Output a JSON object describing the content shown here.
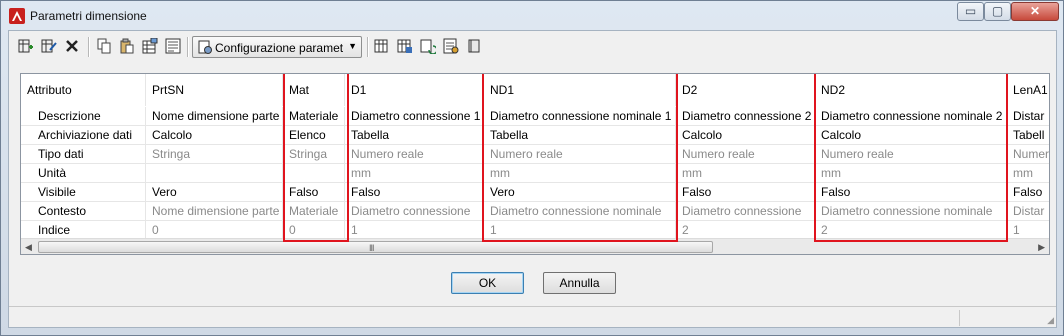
{
  "window": {
    "title": "Parametri dimensione",
    "min_glyph": "▭",
    "max_glyph": "▢",
    "close_glyph": "✕"
  },
  "toolbar": {
    "config_label": "Configurazione paramet",
    "config_arrow": "▼"
  },
  "grid": {
    "columns": [
      {
        "header": "Attributo"
      },
      {
        "header": "PrtSN"
      },
      {
        "header": "Mat"
      },
      {
        "header": "D1"
      },
      {
        "header": "ND1"
      },
      {
        "header": "D2"
      },
      {
        "header": "ND2"
      },
      {
        "header": "LenA1"
      }
    ],
    "rows": [
      {
        "attribute": "Descrizione",
        "gray": false,
        "cells": [
          "Nome dimensione parte",
          "Materiale",
          "Diametro connessione 1",
          "Diametro connessione nominale 1",
          "Diametro connessione 2",
          "Diametro connessione nominale 2",
          "Distar"
        ]
      },
      {
        "attribute": "Archiviazione dati",
        "gray": false,
        "cells": [
          "Calcolo",
          "Elenco",
          "Tabella",
          "Tabella",
          "Calcolo",
          "Calcolo",
          "Tabell"
        ]
      },
      {
        "attribute": "Tipo dati",
        "gray": true,
        "cells": [
          "Stringa",
          "Stringa",
          "Numero reale",
          "Numero reale",
          "Numero reale",
          "Numero reale",
          "Numer"
        ]
      },
      {
        "attribute": "Unità",
        "gray": true,
        "cells": [
          "",
          "",
          "mm",
          "mm",
          "mm",
          "mm",
          "mm"
        ]
      },
      {
        "attribute": "Visibile",
        "gray": false,
        "cells": [
          "Vero",
          "Falso",
          "Falso",
          "Vero",
          "Falso",
          "Falso",
          "Falso"
        ]
      },
      {
        "attribute": "Contesto",
        "gray": true,
        "cells": [
          "Nome dimensione parte",
          "Materiale",
          "Diametro connessione",
          "Diametro connessione nominale",
          "Diametro connessione",
          "Diametro connessione nominale",
          "Distar"
        ]
      },
      {
        "attribute": "Indice",
        "gray": true,
        "cells": [
          "0",
          "0",
          "1",
          "1",
          "2",
          "2",
          "1"
        ]
      }
    ],
    "scroll_left": "◀",
    "scroll_right": "▶",
    "scroll_grip": "III"
  },
  "buttons": {
    "ok": "OK",
    "cancel": "Annulla"
  },
  "colors": {
    "highlight": "#e0141e"
  }
}
